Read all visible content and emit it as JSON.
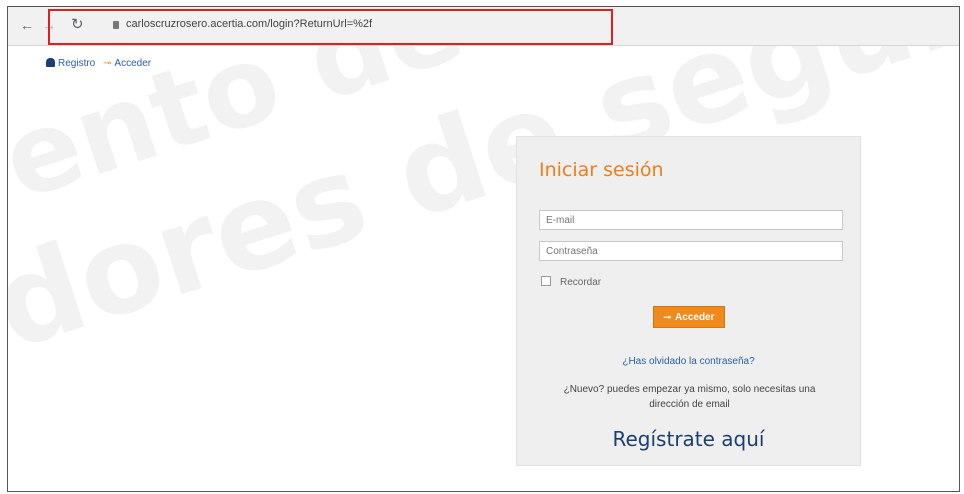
{
  "browser": {
    "url": "carloscruzrosero.acertia.com/login?ReturnUrl=%2f",
    "icons": {
      "back": "←",
      "forward": "→",
      "reload": "↻"
    }
  },
  "top_links": {
    "register": "Registro",
    "login": "Acceder"
  },
  "watermark": {
    "line1": "ento de",
    "line2": "dores de seguros e"
  },
  "login": {
    "title": "Iniciar sesión",
    "email_placeholder": "E-mail",
    "password_placeholder": "Contraseña",
    "remember_label": "Recordar",
    "submit_label": "Acceder",
    "forgot_link": "¿Has olvidado la contraseña?",
    "new_user_text": "¿Nuevo? puedes empezar ya mismo, solo necesitas una dirección de email",
    "register_link": "Regístrate aquí"
  },
  "colors": {
    "accent": "#f08a1c",
    "link": "#2b5fa8",
    "brand_dark": "#1c3f72",
    "highlight": "#e02020"
  }
}
